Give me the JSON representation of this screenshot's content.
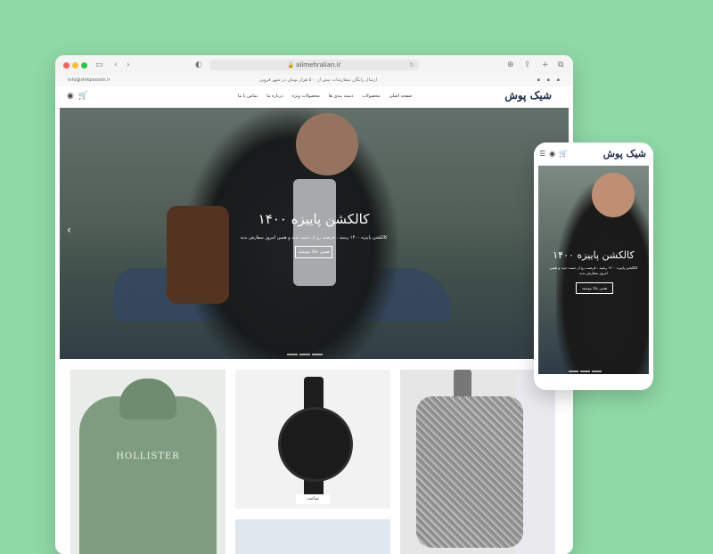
{
  "browser": {
    "url": "alimehralian.ir",
    "topstrip": {
      "email": "info@shikpooosh.ir",
      "notice": "ارسال رایگان سفارشات بیش از ۵۰۰ هزار تومان در شهر قزوین",
      "socials": "▪ ▪ ▪"
    },
    "nav": {
      "logo": "شیک پوش",
      "menu": [
        "صفحه اصلی",
        "محصولات",
        "دسته بندی ها",
        "محصولات ویژه",
        "درباره ما",
        "تماس با ما"
      ],
      "icons": [
        "user-icon",
        "cart-icon"
      ]
    },
    "hero": {
      "title": "کالکشن پاییزه ۱۴۰۰",
      "subtitle": "کالکشن پاییزه ۱۴۰۰ رسید ، فرصت رو از دست ندید و همین امروز سفارش بدید",
      "button": "همین حالا بپوشید"
    },
    "products": {
      "hoodie_print": "HOLLISTER",
      "watch_label": "ساعت"
    }
  },
  "phone": {
    "logo": "شیک پوش",
    "icons": [
      "menu-icon",
      "user-icon",
      "cart-icon"
    ],
    "hero": {
      "title": "کالکشن پاییزه ۱۴۰۰",
      "subtitle": "کالکشن پاییزه ۱۴۰۰ رسید ، فرصت رو از دست ندید و همین امروز سفارش بدید",
      "button": "همین حالا بپوشید"
    }
  },
  "colors": {
    "background": "#8fd9a6",
    "logo": "#1b2a48"
  }
}
